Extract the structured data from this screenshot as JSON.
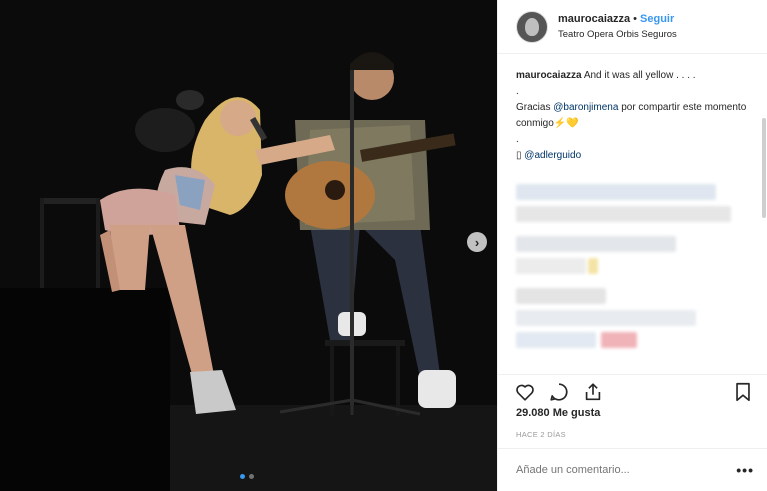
{
  "header": {
    "username": "maurocaiazza",
    "separator": "•",
    "follow_label": "Seguir",
    "location": "Teatro Opera Orbis Seguros"
  },
  "caption": {
    "username": "maurocaiazza",
    "text": "And it was all yellow . . . .",
    "dot1": ".",
    "thanks_prefix": "Gracias",
    "mention": "@baronjimena",
    "thanks_suffix": "por compartir este momento conmigo",
    "emoji": "⚡💛",
    "dot2": ".",
    "camera_icon": "▯",
    "credit_mention": "@adlerguido"
  },
  "actions": {
    "like_icon": "heart-icon",
    "comment_icon": "comment-icon",
    "share_icon": "share-icon",
    "save_icon": "bookmark-icon"
  },
  "likes": "29.080 Me gusta",
  "time": "HACE 2 DÍAS",
  "add_comment": {
    "placeholder": "Añade un comentario...",
    "more": "•••"
  },
  "photo": {
    "next_arrow": "›",
    "carousel_count": 2,
    "carousel_active": 1
  },
  "colors": {
    "link": "#3897f0",
    "mention": "#003569",
    "photo_bg": "#0a0a0a"
  }
}
